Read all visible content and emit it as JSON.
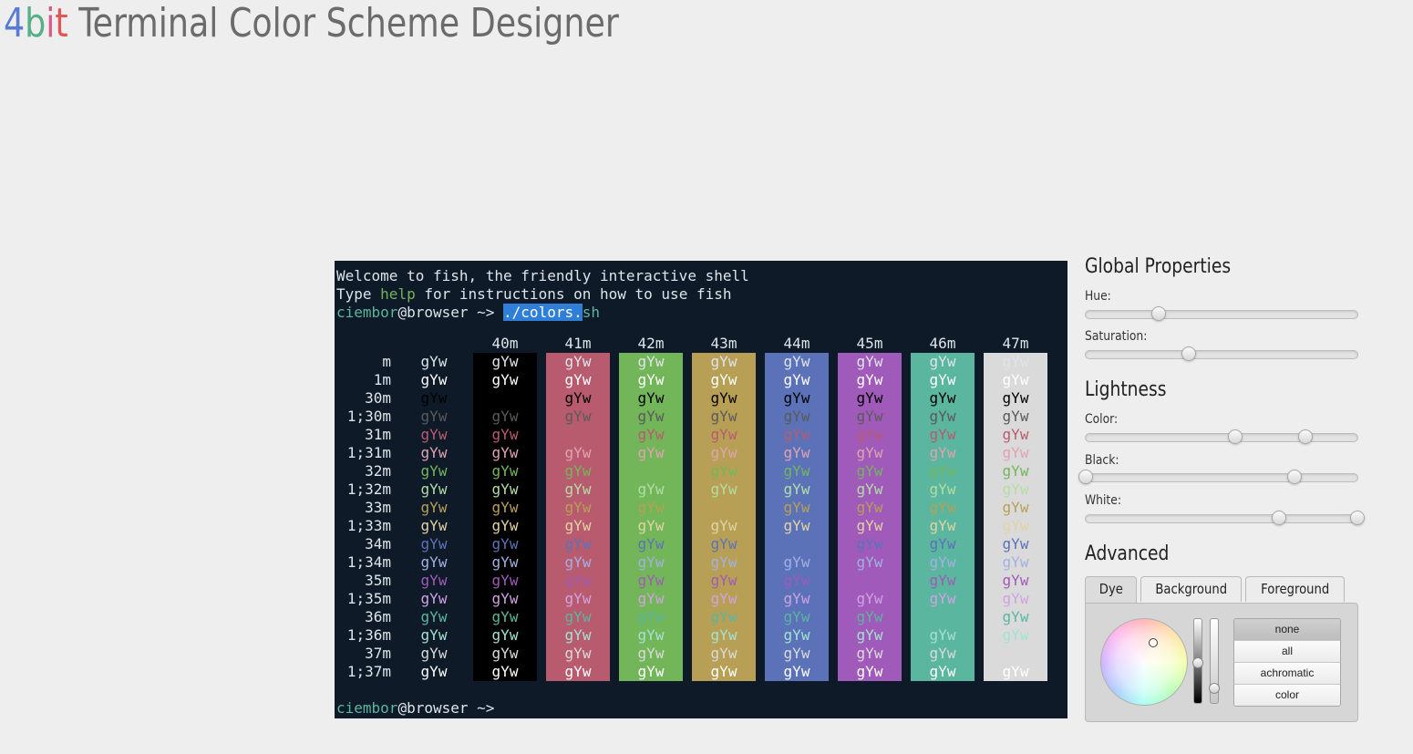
{
  "header": {
    "logo_parts": [
      {
        "text": "4",
        "color": "#5a7bd0"
      },
      {
        "text": "b",
        "color": "#55b08a"
      },
      {
        "text": "i",
        "color": "#d65a8c"
      },
      {
        "text": "t",
        "color": "#e05555"
      }
    ],
    "title": " Terminal Color Scheme Designer"
  },
  "terminal": {
    "welcome_line": "Welcome to fish, the friendly interactive shell",
    "help_line_pre": "Type ",
    "help_word": "help",
    "help_line_post": " for instructions on how to use fish",
    "prompt_user": "ciembor",
    "prompt_host": "@browser ~> ",
    "command_selected": "./colors.",
    "command_rest": "sh",
    "final_prompt_user": "ciembor",
    "final_prompt_host": "@browser ~>",
    "sample_text": "gYw",
    "bg_headers": [
      "40m",
      "41m",
      "42m",
      "43m",
      "44m",
      "45m",
      "46m",
      "47m"
    ],
    "row_labels": [
      "m",
      "1m",
      "30m",
      "1;30m",
      "31m",
      "1;31m",
      "32m",
      "1;32m",
      "33m",
      "1;33m",
      "34m",
      "1;34m",
      "35m",
      "1;35m",
      "36m",
      "1;36m",
      "37m",
      "1;37m"
    ],
    "background_colors": [
      "#000000",
      "#b95b6f",
      "#73b65a",
      "#b7a055",
      "#5b72b9",
      "#a05ab9",
      "#5ab69e",
      "#dadada"
    ],
    "foreground_colors": [
      "#dde4ea",
      "#ffffff",
      "#000000",
      "#5a5a5a",
      "#b95b6f",
      "#e0a3b0",
      "#73b65a",
      "#b3dea3",
      "#b7a055",
      "#e2d3a3",
      "#5b72b9",
      "#a3b0e2",
      "#a05ab9",
      "#cfa3e2",
      "#5ab69e",
      "#a3e2d2",
      "#dadada",
      "#ffffff"
    ],
    "term_bg": "#0e1a28",
    "prompt_user_color": "#5ab69e",
    "help_color": "#73b65a",
    "selection_color": "#2f7fd8"
  },
  "panel": {
    "global_title": "Global Properties",
    "hue_label": "Hue:",
    "saturation_label": "Saturation:",
    "lightness_title": "Lightness",
    "color_label": "Color:",
    "black_label": "Black:",
    "white_label": "White:",
    "advanced_title": "Advanced",
    "tabs": [
      "Dye",
      "Background",
      "Foreground"
    ],
    "active_tab": "Dye",
    "filter_buttons": [
      "none",
      "all",
      "achromatic",
      "color"
    ],
    "selected_filter": "none",
    "hue_value": 0.27,
    "saturation_value": 0.38,
    "color_range": [
      0.55,
      0.81
    ],
    "black_range": [
      0.0,
      0.77
    ],
    "white_range": [
      0.71,
      1.0
    ],
    "dye_hue_level": 0.5,
    "dye_saturation_level": 0.8
  }
}
